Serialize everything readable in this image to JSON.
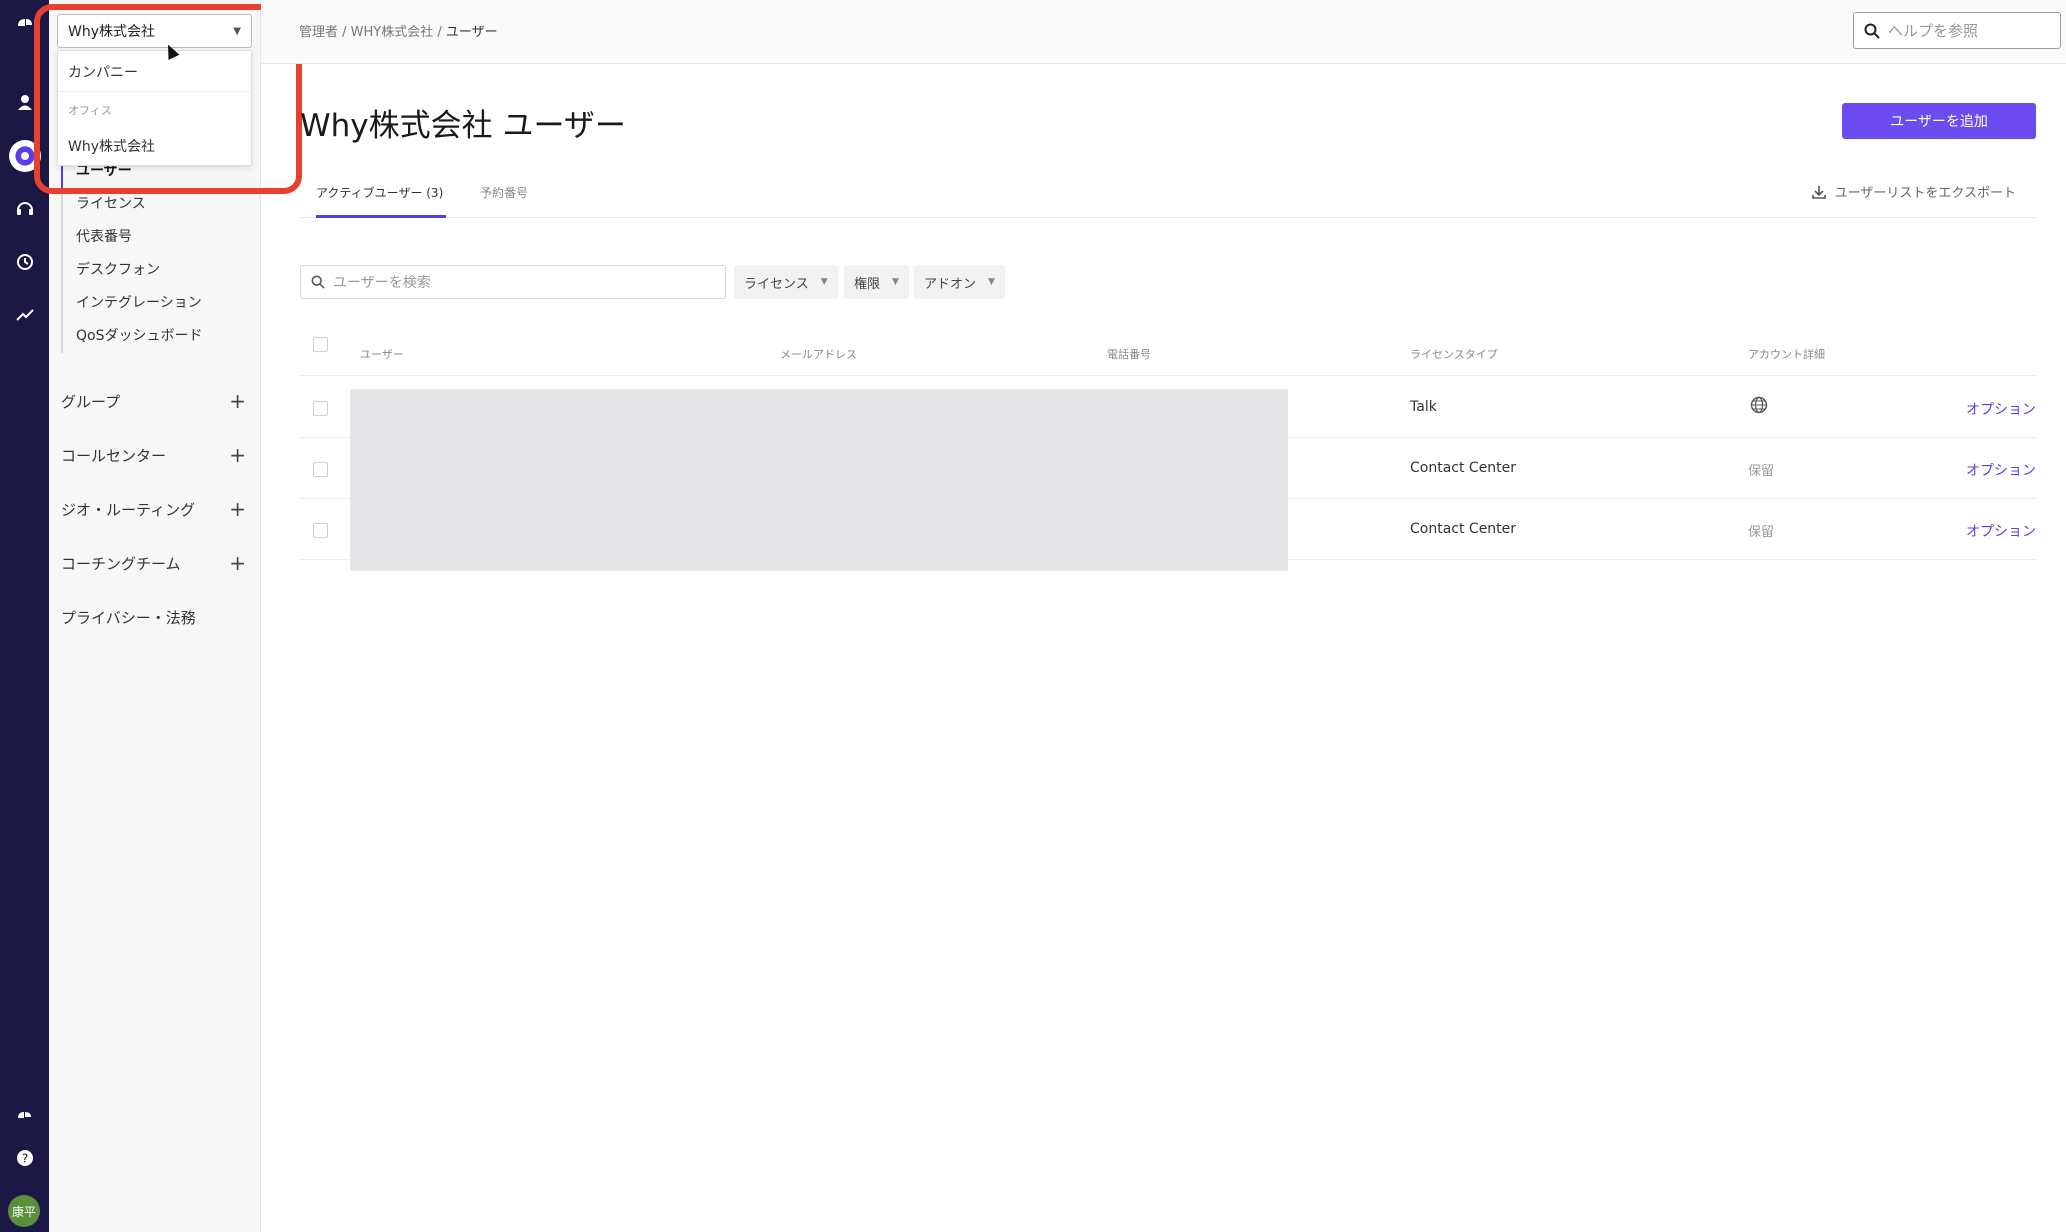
{
  "breadcrumb": {
    "part1": "管理者",
    "sep1": " / ",
    "part2": "WHY株式会社",
    "sep2": " / ",
    "current": "ユーザー"
  },
  "help_search": {
    "placeholder": "ヘルプを参照",
    "icon": "search-icon"
  },
  "office_select": {
    "value": "Why株式会社",
    "options": {
      "company": "カンパニー",
      "section_label": "オフィス",
      "office": "Why株式会社"
    }
  },
  "sidebar": {
    "sub_items": [
      "ユーザー",
      "ライセンス",
      "代表番号",
      "デスクフォン",
      "インテグレーション",
      "QoSダッシュボード"
    ],
    "groups": [
      "グループ",
      "コールセンター",
      "ジオ・ルーティング",
      "コーチングチーム"
    ],
    "privacy": "プライバシー・法務",
    "plus": "+"
  },
  "avatar": {
    "initials": "康平"
  },
  "page": {
    "title": "Why株式会社 ユーザー",
    "add_user_label": "ユーザーを追加"
  },
  "tabs": {
    "active_users": "アクティブユーザー (3)",
    "reserved_numbers": "予約番号",
    "export": "ユーザーリストをエクスポート"
  },
  "filters": {
    "search_placeholder": "ユーザーを検索",
    "license": "ライセンス",
    "permission": "権限",
    "addon": "アドオン"
  },
  "table": {
    "headers": {
      "user": "ユーザー",
      "email": "メールアドレス",
      "phone": "電話番号",
      "license_type": "ライセンスタイプ",
      "account_detail": "アカウント詳細"
    },
    "rows": [
      {
        "license": "Talk",
        "account": "globe-icon",
        "option": "オプション"
      },
      {
        "license": "Contact Center",
        "account": "保留",
        "option": "オプション"
      },
      {
        "license": "Contact Center",
        "account": "保留",
        "option": "オプション"
      }
    ]
  },
  "colors": {
    "accent": "#6c4cf0",
    "rail": "#1c1846",
    "highlight": "#e8402f"
  }
}
